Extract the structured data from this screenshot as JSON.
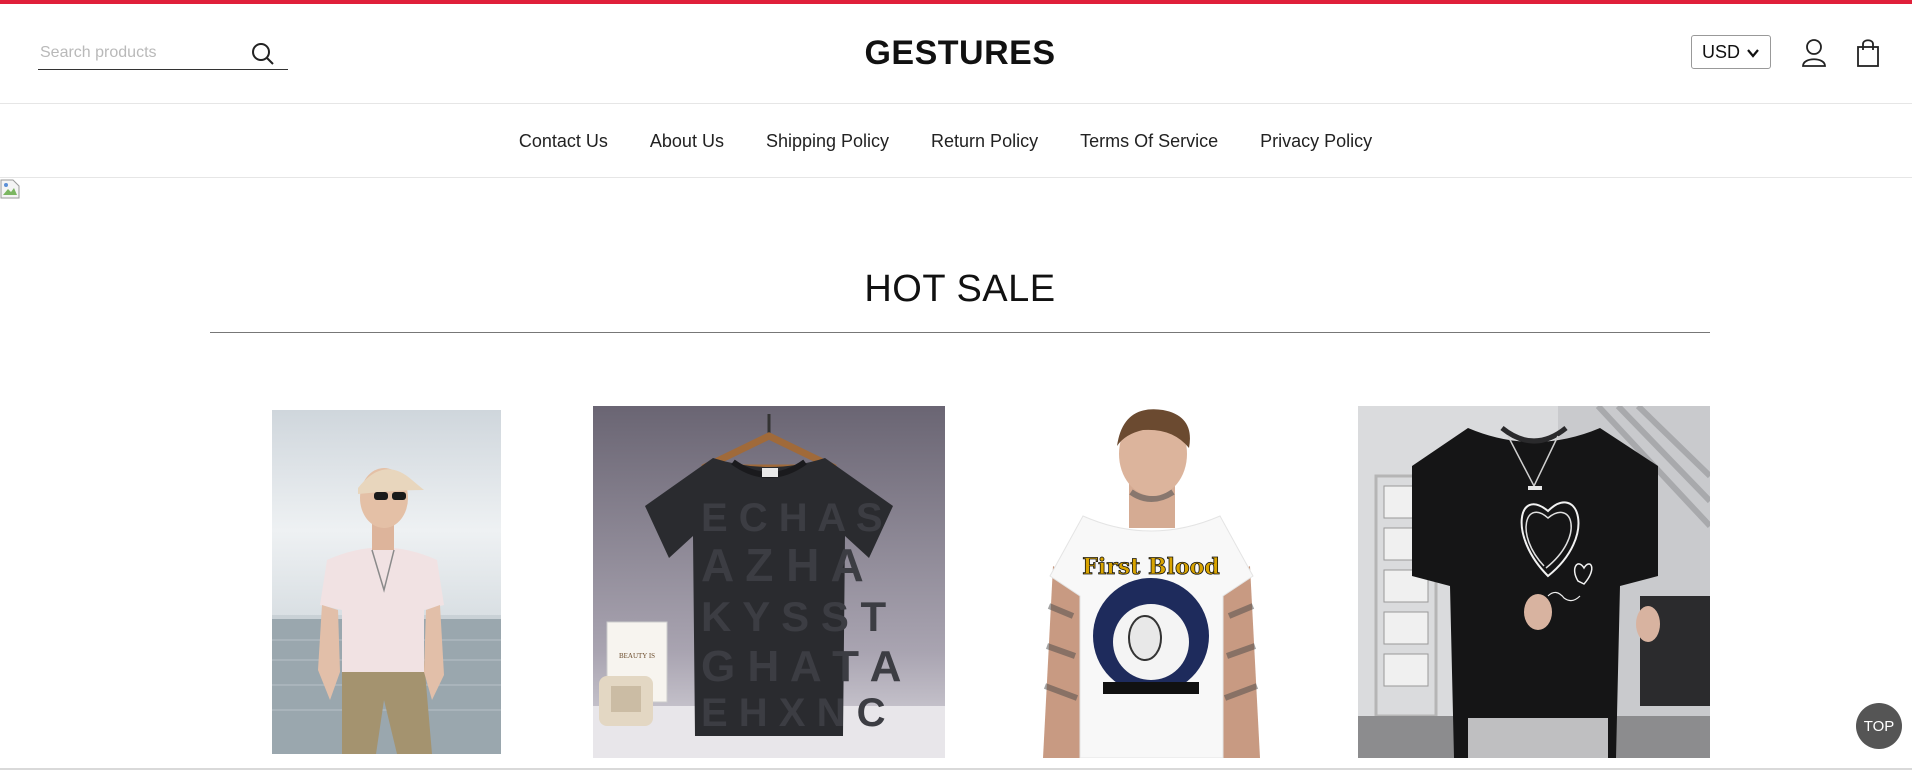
{
  "header": {
    "search_placeholder": "Search products",
    "logo": "GESTURES",
    "currency": "USD",
    "accent_color": "#e0203a"
  },
  "nav": {
    "items": [
      {
        "label": "Contact Us"
      },
      {
        "label": "About Us"
      },
      {
        "label": "Shipping Policy"
      },
      {
        "label": "Return Policy"
      },
      {
        "label": "Terms Of Service"
      },
      {
        "label": "Privacy Policy"
      }
    ]
  },
  "section": {
    "title": "HOT SALE"
  },
  "products": [
    {
      "image": "man-cap-pink-tshirt-sea"
    },
    {
      "image": "black-letter-print-tshirt-hanger",
      "tag_text": "BEAUTY IS"
    },
    {
      "image": "white-graphic-tshirt-model",
      "graphic_text": "First Blood"
    },
    {
      "image": "black-heart-sketch-tshirt"
    }
  ],
  "back_to_top": "TOP"
}
